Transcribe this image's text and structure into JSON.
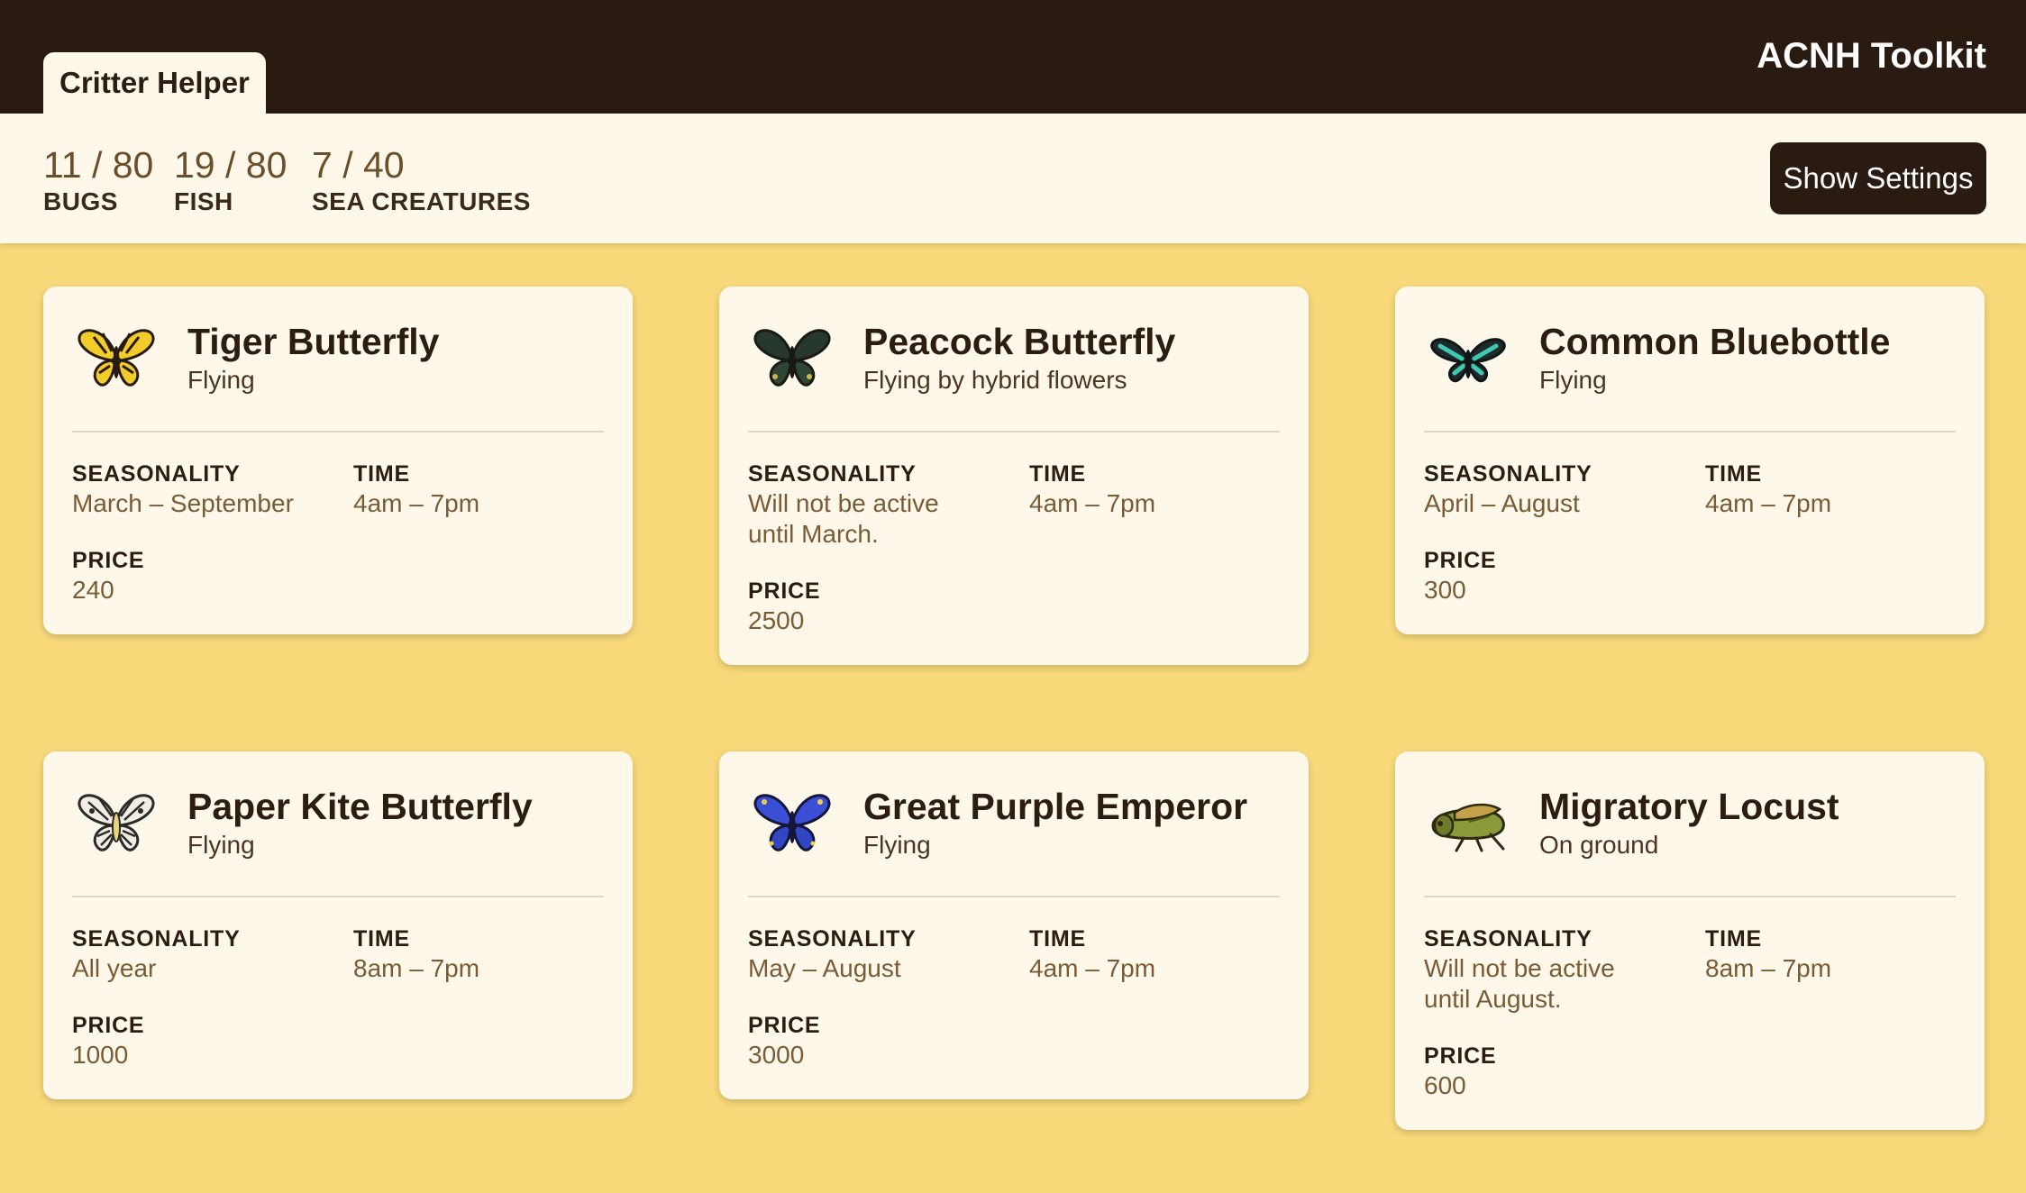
{
  "header": {
    "tab_label": "Critter Helper",
    "app_title": "ACNH Toolkit"
  },
  "stats": [
    {
      "count": "11 / 80",
      "label": "BUGS"
    },
    {
      "count": "19 / 80",
      "label": "FISH"
    },
    {
      "count": "7 / 40",
      "label": "SEA CREATURES"
    }
  ],
  "settings_button": {
    "label": "Show Settings"
  },
  "field_labels": {
    "seasonality": "SEASONALITY",
    "time": "TIME",
    "price": "PRICE"
  },
  "cards": [
    {
      "name": "Tiger Butterfly",
      "location": "Flying",
      "seasonality": "March – September",
      "time": "4am – 7pm",
      "price": "240",
      "icon": "tiger-butterfly-icon"
    },
    {
      "name": "Peacock Butterfly",
      "location": "Flying by hybrid flowers",
      "seasonality": "Will not be active until March.",
      "time": "4am – 7pm",
      "price": "2500",
      "icon": "peacock-butterfly-icon"
    },
    {
      "name": "Common Bluebottle",
      "location": "Flying",
      "seasonality": "April – August",
      "time": "4am – 7pm",
      "price": "300",
      "icon": "common-bluebottle-icon"
    },
    {
      "name": "Paper Kite Butterfly",
      "location": "Flying",
      "seasonality": "All year",
      "time": "8am – 7pm",
      "price": "1000",
      "icon": "paper-kite-butterfly-icon"
    },
    {
      "name": "Great Purple Emperor",
      "location": "Flying",
      "seasonality": "May – August",
      "time": "4am – 7pm",
      "price": "3000",
      "icon": "great-purple-emperor-icon"
    },
    {
      "name": "Migratory Locust",
      "location": "On ground",
      "seasonality": "Will not be active until August.",
      "time": "8am – 7pm",
      "price": "600",
      "icon": "migratory-locust-icon"
    }
  ],
  "colors": {
    "page_background": "#F8D97A",
    "topbar": "#2a1b12",
    "card_background": "#FDF8EA",
    "value_text": "#7a5b34"
  }
}
